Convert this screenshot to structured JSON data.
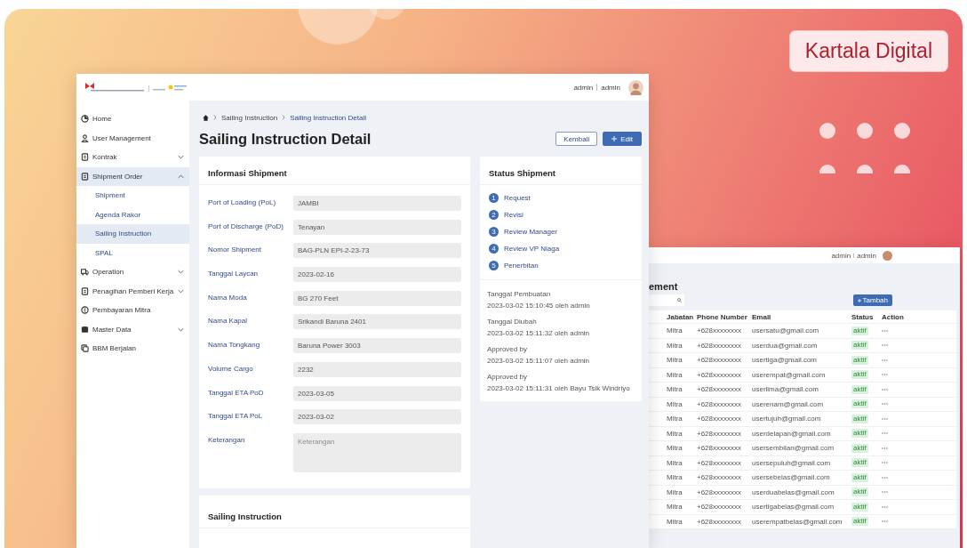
{
  "brand_badge": "Kartala Digital",
  "main_window": {
    "header": {
      "user_name": "admin",
      "user_role": "admin"
    },
    "sidebar": {
      "items": [
        {
          "label": "Home",
          "kind": "link",
          "selected": false
        },
        {
          "label": "User Management",
          "kind": "link",
          "selected": false
        },
        {
          "label": "Kontrak",
          "kind": "group",
          "expanded": false,
          "selected": false
        },
        {
          "label": "Shipment Order",
          "kind": "group",
          "expanded": true,
          "selected": true,
          "children": [
            {
              "label": "Shipment",
              "selected": false
            },
            {
              "label": "Agenda Rakor",
              "selected": false
            },
            {
              "label": "Sailing Instruction",
              "selected": true
            },
            {
              "label": "SPAL",
              "selected": false
            }
          ]
        },
        {
          "label": "Operation",
          "kind": "group",
          "expanded": false,
          "selected": false
        },
        {
          "label": "Penagihan Pemberi Kerja",
          "kind": "group",
          "expanded": false,
          "selected": false
        },
        {
          "label": "Pembayaran Mitra",
          "kind": "link",
          "selected": false
        },
        {
          "label": "Master Data",
          "kind": "group",
          "expanded": false,
          "selected": false
        },
        {
          "label": "BBM Berjalan",
          "kind": "link",
          "selected": false
        }
      ]
    },
    "breadcrumb": [
      "Sailing Instruction",
      "Sailing Instruction Detail"
    ],
    "page_title": "Sailing Instruction Detail",
    "buttons": [
      {
        "label": "Kembali",
        "kind": "outline"
      },
      {
        "label": "Edit",
        "kind": "primary"
      }
    ],
    "shipment_card": {
      "title": "Informasi Shipment",
      "fields": [
        {
          "label": "Port of Loading (PoL)",
          "value": "JAMBI"
        },
        {
          "label": "Port of Discharge (PoD)",
          "value": "Tenayan"
        },
        {
          "label": "Nomor Shipment",
          "value": "BAG-PLN EPI-2-23-73"
        },
        {
          "label": "Tanggal Laycan",
          "value": "2023-02-16"
        },
        {
          "label": "Nama Moda",
          "value": "BG 270 Feet"
        },
        {
          "label": "Nama Kapal",
          "value": "Srikandi Baruna 2401"
        },
        {
          "label": "Nama Tongkang",
          "value": "Baruna Power 3003"
        },
        {
          "label": "Volume Cargo",
          "value": "2232"
        },
        {
          "label": "Tanggal ETA PoD",
          "value": "2023-03-05"
        },
        {
          "label": "Tanggal ETA PoL",
          "value": "2023-03-02"
        },
        {
          "label": "Keterangan",
          "kind": "textarea",
          "placeholder": "Keterangan"
        }
      ]
    },
    "status_card": {
      "title": "Status Shipment",
      "steps": [
        {
          "number": "1",
          "label": "Request"
        },
        {
          "number": "2",
          "label": "Revisi"
        },
        {
          "number": "3",
          "label": "Review Manager"
        },
        {
          "number": "4",
          "label": "Review VP Niaga"
        },
        {
          "number": "5",
          "label": "Penerbitan"
        }
      ],
      "history": [
        {
          "label": "Tanggal Pembuatan",
          "value": "2023-03-02 15:10:45 oleh admin"
        },
        {
          "label": "Tanggal Diubah",
          "value": "2023-03-02 15:11:32 oleh admin"
        },
        {
          "label": "Approved by",
          "value": "2023-03-02 15:11:07 oleh admin"
        },
        {
          "label": "Approved by",
          "value": "2023-03-02 15:11:31 oleh Bayu Tsik Windriyo"
        }
      ]
    },
    "sailing_card": {
      "title": "Sailing Instruction"
    }
  },
  "back_window": {
    "header": {
      "user_name": "admin",
      "user_role": "admin"
    },
    "page_title": "ement",
    "add_button": "Tambah",
    "table": {
      "columns": [
        "Jabatan",
        "Phone Number",
        "Email",
        "Status",
        "Action"
      ],
      "rows": [
        [
          "Mitra",
          "+628xxxxxxxx",
          "usersatu@gmail.com",
          "aktif"
        ],
        [
          "Mitra",
          "+628xxxxxxxx",
          "userdua@gmail.com",
          "aktif"
        ],
        [
          "Mitra",
          "+628xxxxxxxx",
          "usertiga@gmail.com",
          "aktif"
        ],
        [
          "Mitra",
          "+628xxxxxxxx",
          "userempat@gmail.com",
          "aktif"
        ],
        [
          "Mitra",
          "+628xxxxxxxx",
          "userlima@gmail.com",
          "aktif"
        ],
        [
          "Mitra",
          "+628xxxxxxxx",
          "userenam@gmail.com",
          "aktif"
        ],
        [
          "Mitra",
          "+628xxxxxxxx",
          "usertujuh@gmail.com",
          "aktif"
        ],
        [
          "Mitra",
          "+628xxxxxxxx",
          "userdelapan@gmail.com",
          "aktif"
        ],
        [
          "Mitra",
          "+628xxxxxxxx",
          "usersembilan@gmail.com",
          "aktif"
        ],
        [
          "Mitra",
          "+628xxxxxxxx",
          "usersepuluh@gmail.com",
          "aktif"
        ],
        [
          "Mitra",
          "+628xxxxxxxx",
          "usersebelas@gmail.com",
          "aktif"
        ],
        [
          "Mitra",
          "+628xxxxxxxx",
          "userduabelas@gmail.com",
          "aktif"
        ],
        [
          "Mitra",
          "+628xxxxxxxx",
          "usertigabelas@gmail.com",
          "aktif"
        ],
        [
          "Mitra",
          "+628xxxxxxxx",
          "userempatbelas@gmail.com",
          "aktif"
        ]
      ]
    }
  }
}
